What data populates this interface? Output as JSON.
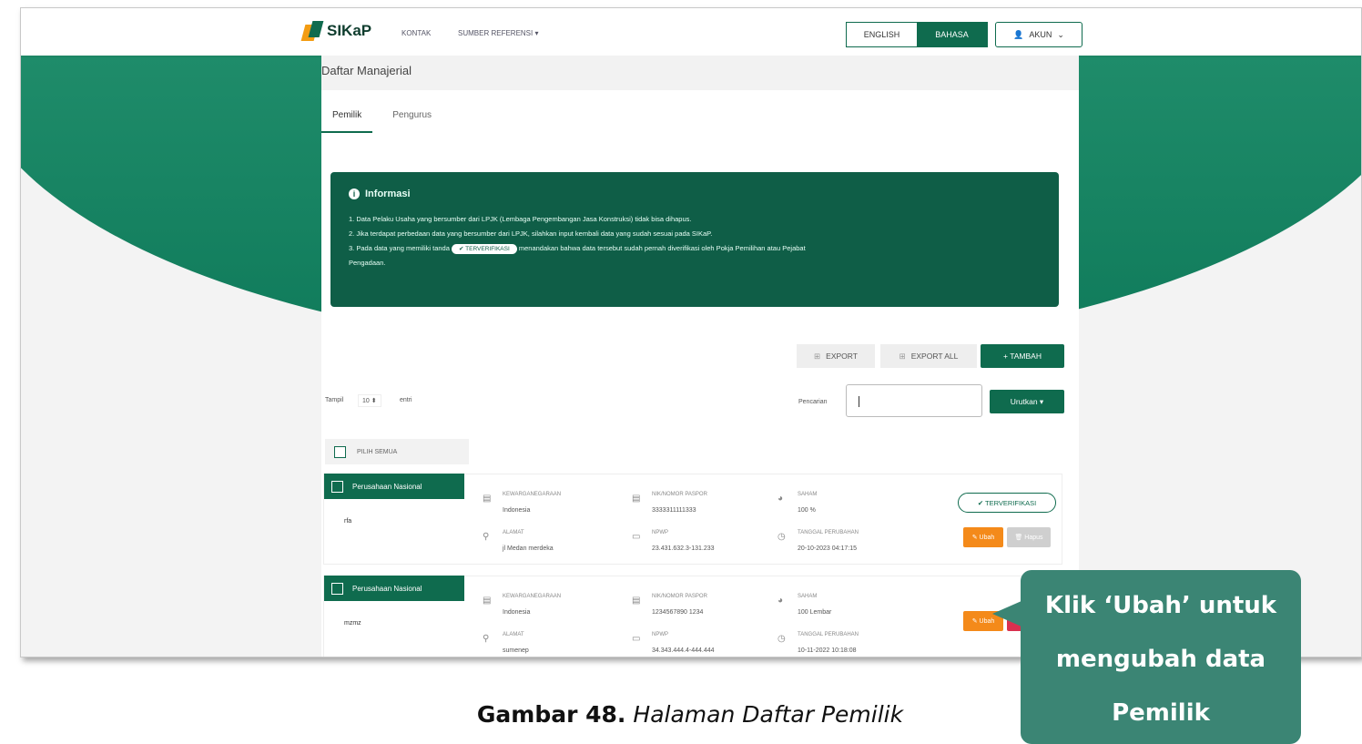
{
  "navbar": {
    "brand": "SIKaP",
    "links": [
      "KONTAK",
      "SUMBER REFERENSI ▾"
    ],
    "lang_english": "ENGLISH",
    "lang_bahasa": "BAHASA",
    "akun_label": "AKUN"
  },
  "page": {
    "title": "Daftar Manajerial",
    "tabs": [
      "Pemilik",
      "Pengurus"
    ]
  },
  "info": {
    "title": "Informasi",
    "line1": "1. Data Pelaku Usaha yang bersumber dari LPJK (Lembaga Pengembangan Jasa Konstruksi) tidak bisa dihapus.",
    "line2": "2. Jika terdapat perbedaan data yang bersumber dari LPJK, silahkan input kembali data yang sudah sesuai pada SIKaP.",
    "line3a": "3. Pada data yang memiliki tanda",
    "badge": "✔ TERVERIFIKASI",
    "line3b": "menandakan bahwa data tersebut sudah pernah diverifikasi oleh Pokja Pemilihan atau Pejabat",
    "line4": "Pengadaan."
  },
  "toolbar": {
    "export": "EXPORT",
    "export_all": "EXPORT ALL",
    "tambah": "+ TAMBAH",
    "tampil_label": "Tampil",
    "tampil_value": "10 ⬍",
    "entri_label": "entri",
    "pencarian_label": "Pencarian",
    "urutkan": "Urutkan ▾",
    "select_all": "PILIH SEMUA"
  },
  "items": [
    {
      "tag": "Perusahaan Nasional",
      "name": "rfa",
      "kewarganegaraan_label": "KEWARGANEGARAAN",
      "kewarganegaraan": "Indonesia",
      "alamat_label": "ALAMAT",
      "alamat": "jl Medan merdeka",
      "nik_label": "NIK/NOMOR PASPOR",
      "nik": "3333311111333",
      "npwp_label": "NPWP",
      "npwp": "23.431.632.3-131.233",
      "saham_label": "SAHAM",
      "saham": "100 %",
      "tanggal_label": "TANGGAL PERUBAHAN",
      "tanggal": "20-10-2023 04:17:15",
      "verified": "✔ TERVERIFIKASI",
      "ubah": "✎ Ubah",
      "hapus": "🗑 Hapus"
    },
    {
      "tag": "Perusahaan Nasional",
      "name": "mzmz",
      "kewarganegaraan_label": "KEWARGANEGARAAN",
      "kewarganegaraan": "Indonesia",
      "alamat_label": "ALAMAT",
      "alamat": "sumenep",
      "nik_label": "NIK/NOMOR PASPOR",
      "nik": "1234567890 1234",
      "npwp_label": "NPWP",
      "npwp": "34.343.444.4-444.444",
      "saham_label": "SAHAM",
      "saham": "100 Lembar",
      "tanggal_label": "TANGGAL PERUBAHAN",
      "tanggal": "10-11-2022 10:18:08",
      "ubah": "✎ Ubah",
      "hapus": "🗑"
    }
  ],
  "callout": {
    "line1": "Klik ‘Ubah’ untuk",
    "line2": "mengubah data",
    "line3": "Pemilik"
  },
  "caption": {
    "bold": "Gambar 48.",
    "italic": "Halaman Daftar Pemilik"
  },
  "colors": {
    "primary_green": "#0f6b4e",
    "orange": "#f48a1a",
    "red": "#d9304f",
    "callout": "#3b8574"
  }
}
